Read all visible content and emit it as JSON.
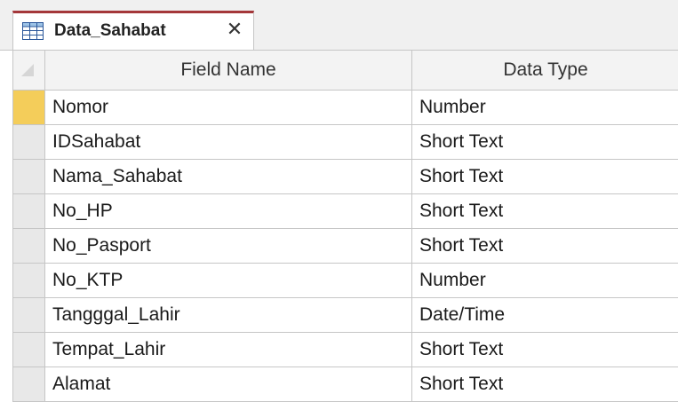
{
  "tab": {
    "title": "Data_Sahabat",
    "icon": "table-icon",
    "close_glyph": "✕",
    "accent_color": "#a4373a"
  },
  "table": {
    "columns": [
      "Field Name",
      "Data Type"
    ],
    "current_row_index": 0,
    "current_row_color": "#f4cd5a",
    "rows": [
      {
        "field_name": "Nomor",
        "data_type": "Number"
      },
      {
        "field_name": "IDSahabat",
        "data_type": "Short Text"
      },
      {
        "field_name": "Nama_Sahabat",
        "data_type": "Short Text"
      },
      {
        "field_name": "No_HP",
        "data_type": "Short Text"
      },
      {
        "field_name": "No_Pasport",
        "data_type": "Short Text"
      },
      {
        "field_name": "No_KTP",
        "data_type": "Number"
      },
      {
        "field_name": "Tangggal_Lahir",
        "data_type": "Date/Time"
      },
      {
        "field_name": "Tempat_Lahir",
        "data_type": "Short Text"
      },
      {
        "field_name": "Alamat",
        "data_type": "Short Text"
      }
    ]
  }
}
